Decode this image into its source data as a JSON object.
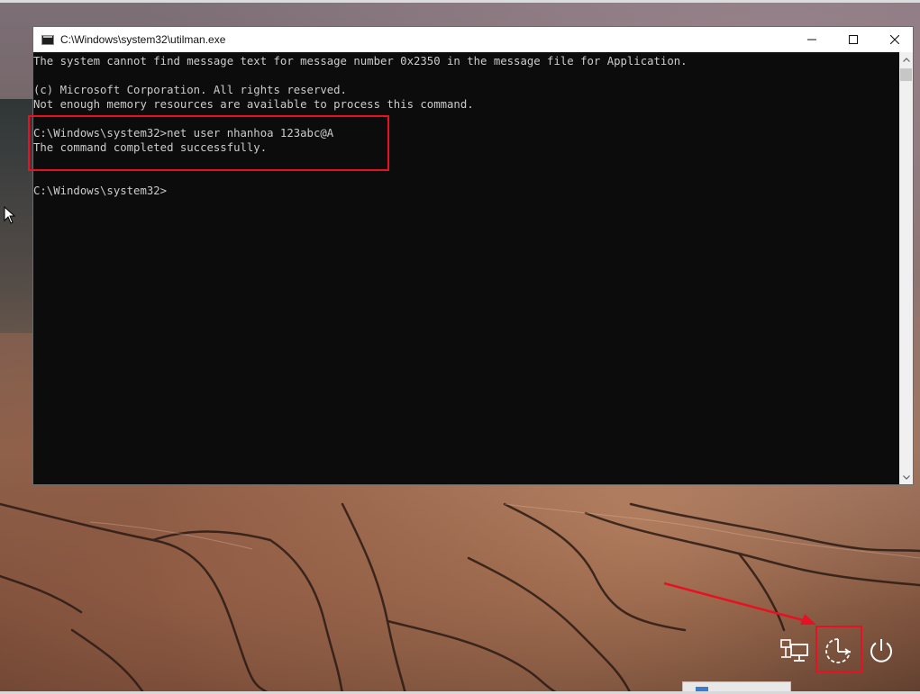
{
  "window": {
    "title": "C:\\Windows\\system32\\utilman.exe",
    "icon": "console-app-icon"
  },
  "console": {
    "lines": [
      "The system cannot find message text for message number 0x2350 in the message file for Application.",
      "",
      "(c) Microsoft Corporation. All rights reserved.",
      "Not enough memory resources are available to process this command.",
      "",
      "C:\\Windows\\system32>net user nhanhoa 123abc@A",
      "The command completed successfully.",
      "",
      "",
      "C:\\Windows\\system32>"
    ]
  },
  "lock_screen": {
    "icons": [
      "network-icon",
      "ease-of-access-icon",
      "power-icon"
    ]
  },
  "colors": {
    "console_bg": "#0c0c0c",
    "console_text": "#cccccc",
    "annotation": "#e81123"
  }
}
